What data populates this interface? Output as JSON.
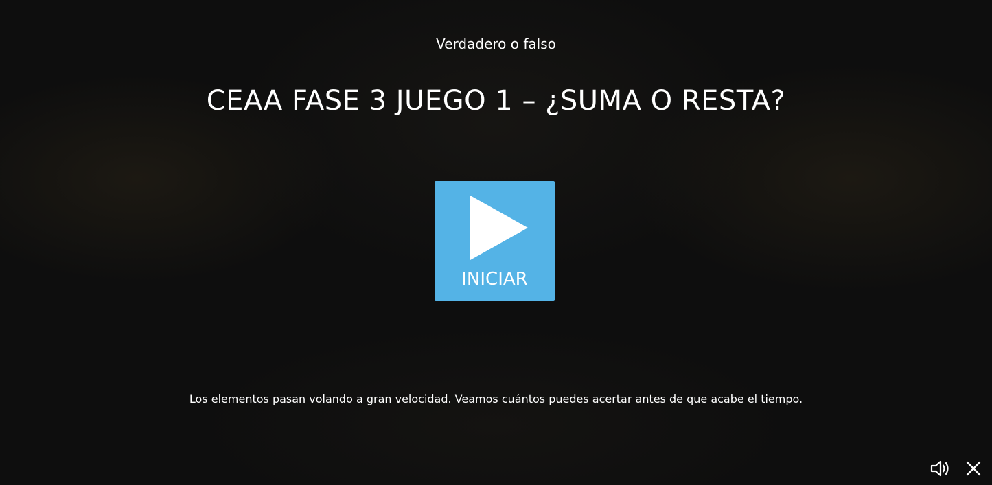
{
  "activity": {
    "type_label": "Verdadero o falso",
    "title": "CEAA FASE 3 JUEGO 1 – ¿SUMA O RESTA?",
    "description": "Los elementos pasan volando a gran velocidad. Veamos cuántos puedes acertar antes de que acabe el tiempo."
  },
  "start_button": {
    "label": "INICIAR",
    "icon": "play-icon",
    "color": "#54b3e6"
  },
  "controls": {
    "sound_icon": "speaker-icon",
    "close_icon": "close-icon"
  }
}
